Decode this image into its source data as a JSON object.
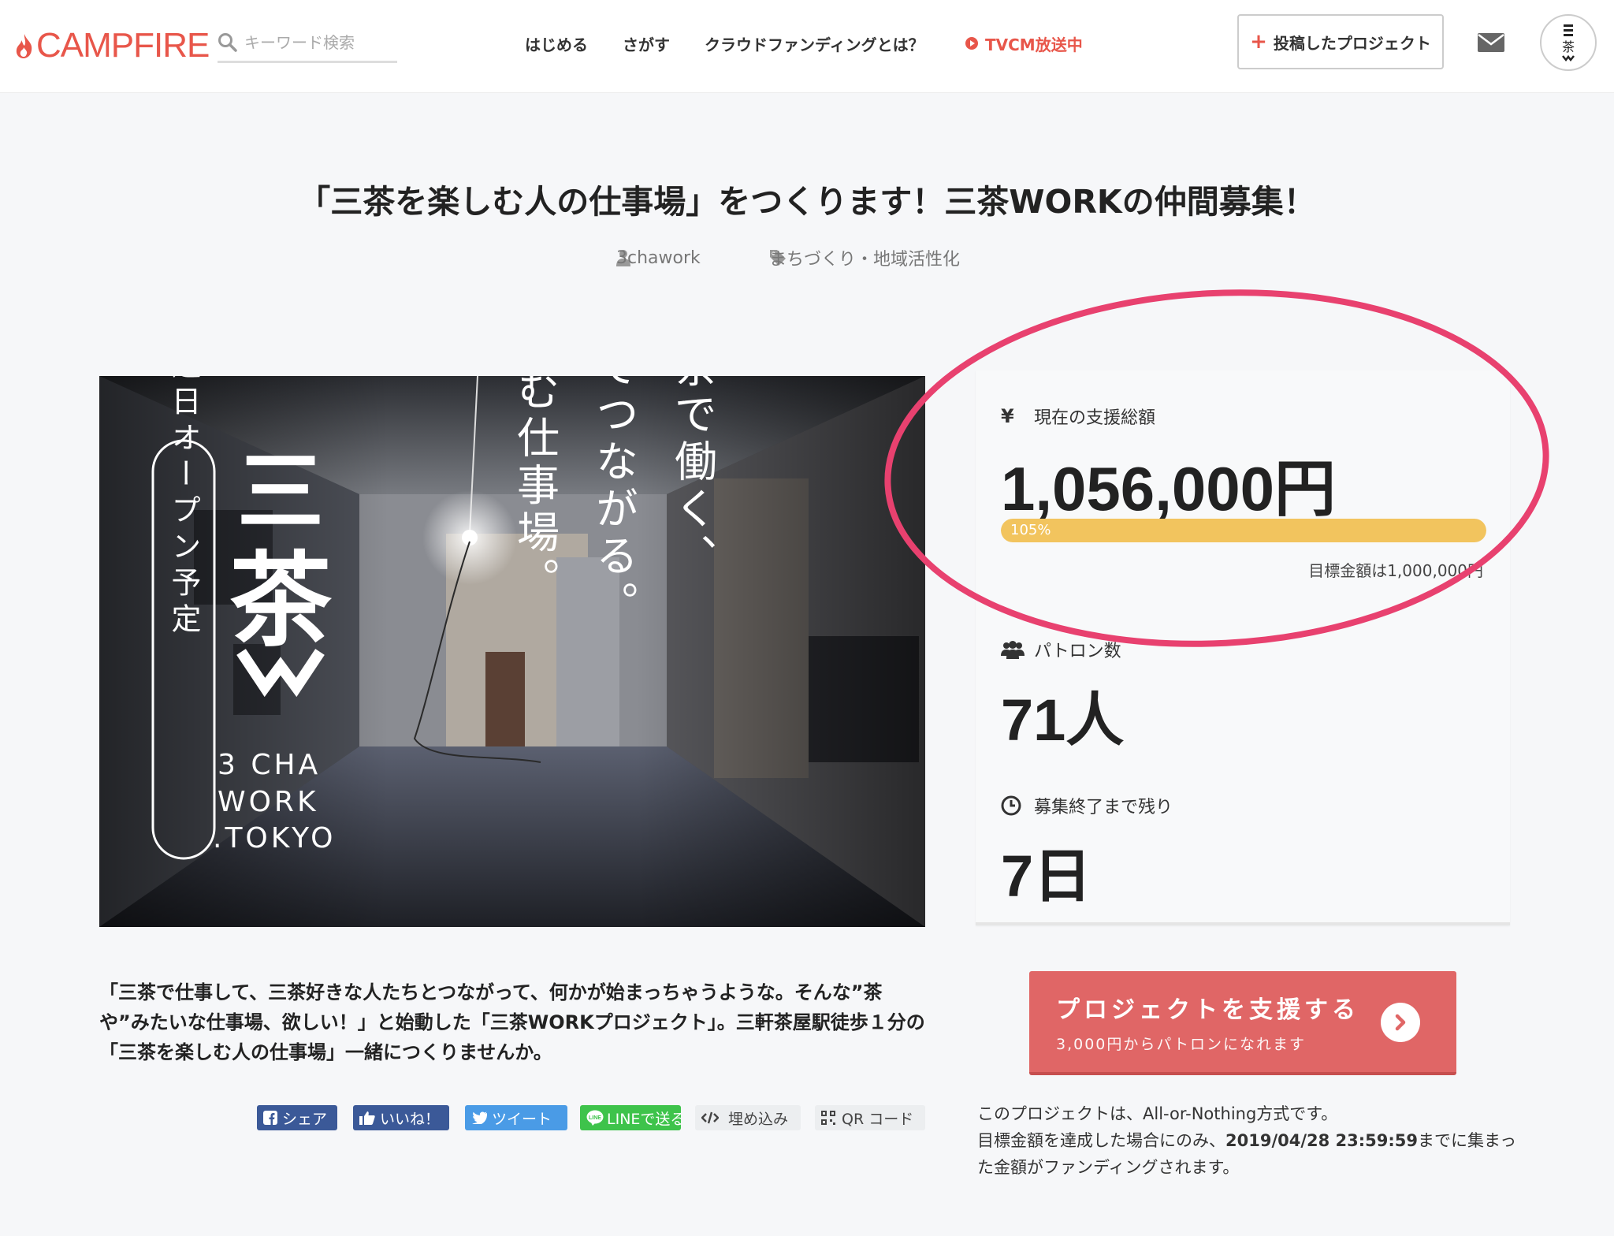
{
  "header": {
    "logo": "CAMPFIRE",
    "search_placeholder": "キーワード検索",
    "nav": [
      "はじめる",
      "さがす",
      "クラウドファンディングとは？",
      "TVCM放送中"
    ],
    "post_button": "投稿したプロジェクト"
  },
  "project": {
    "title": "「三茶を楽しむ人の仕事場」をつくります！三茶WORKの仲間募集！",
    "owner": "3chawork",
    "category": "まちづくり・地域活性化"
  },
  "hero": {
    "badge": "近日オープン予定",
    "logo_kanji_top": "三",
    "logo_kanji_main": "茶",
    "logo_text_lines": [
      "3 CHA",
      "WORK",
      ".TOKYO"
    ],
    "copy_columns": [
      "三茶で働く、",
      "三茶でつながる。",
      "楽しむ仕事場。"
    ]
  },
  "stats": {
    "total_label": "現在の支援総額",
    "total_value": "1,056,000円",
    "progress_percent": 105,
    "progress_label": "105%",
    "goal_text": "目標金額は1,000,000円",
    "patrons_label": "パトロン数",
    "patrons_value": "71人",
    "remaining_label": "募集終了まで残り",
    "remaining_value": "7日"
  },
  "description": "「三茶で仕事して、三茶好きな人たちとつながって、何かが始まっちゃうような。そんな”茶や”みたいな仕事場、欲しい！」と始動した「三茶WORKプロジェクト」。三軒茶屋駅徒歩１分の「三茶を楽しむ人の仕事場」一緒につくりませんか。",
  "share": {
    "facebook_share": "シェア",
    "facebook_like": "いいね！",
    "tweet": "ツイート",
    "line": "LINEで送る",
    "embed": "埋め込み",
    "qr": "QR コード"
  },
  "support": {
    "button_title": "プロジェクトを支援する",
    "button_sub": "3,000円からパトロンになれます"
  },
  "note": {
    "line1": "このプロジェクトは、All-or-Nothing方式です。",
    "line2_pre": "目標金額を達成した場合にのみ、",
    "deadline": "2019/04/28 23:59:59",
    "line2_post": "までに集まった金額がファンディングされます。"
  },
  "colors": {
    "brand": "#e8564a",
    "progress": "#f2c45e",
    "support_button": "#e06666",
    "highlight_ellipse": "#e8416f",
    "facebook": "#3b5998",
    "twitter": "#4a9be6",
    "line": "#3ec34b"
  }
}
